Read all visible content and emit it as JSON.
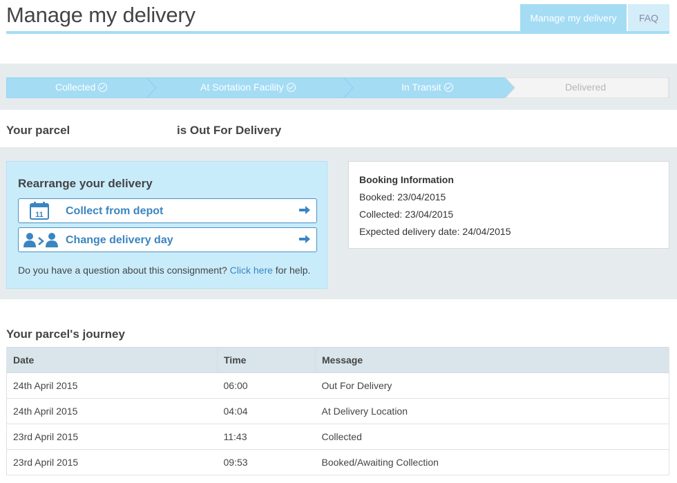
{
  "header": {
    "title": "Manage my delivery",
    "tabs": [
      {
        "label": "Manage my delivery",
        "active": true
      },
      {
        "label": "FAQ",
        "active": false
      }
    ]
  },
  "progress": {
    "steps": [
      {
        "label": "Collected",
        "done": true
      },
      {
        "label": "At Sortation Facility",
        "done": true
      },
      {
        "label": "In Transit",
        "done": true
      },
      {
        "label": "Delivered",
        "done": false
      }
    ],
    "active_color": "#a4dcf4",
    "inactive_color": "#f4f4f4"
  },
  "parcel": {
    "label": "Your parcel",
    "status": "is Out For Delivery"
  },
  "rearrange": {
    "title": "Rearrange your delivery",
    "collect_label": "Collect from depot",
    "collect_icon": "calendar-icon",
    "calendar_day": "11",
    "change_label": "Change delivery day",
    "change_icon": "user-transfer-icon",
    "help_prefix": "Do you have a question about this consignment?",
    "help_link": "Click here",
    "help_suffix": "for help."
  },
  "booking": {
    "title": "Booking Information",
    "booked": "Booked: 23/04/2015",
    "collected": "Collected: 23/04/2015",
    "expected": "Expected delivery date: 24/04/2015"
  },
  "journey": {
    "title": "Your parcel's journey",
    "columns": [
      "Date",
      "Time",
      "Message"
    ],
    "rows": [
      {
        "date": "24th April 2015",
        "time": "06:00",
        "message": "Out For Delivery"
      },
      {
        "date": "24th April 2015",
        "time": "04:04",
        "message": "At Delivery Location"
      },
      {
        "date": "23rd April 2015",
        "time": "11:43",
        "message": "Collected"
      },
      {
        "date": "23rd April 2015",
        "time": "09:53",
        "message": "Booked/Awaiting Collection"
      }
    ]
  },
  "colors": {
    "accent": "#a4dcf4",
    "link": "#3a85c2",
    "panel": "#c9ecfb"
  }
}
